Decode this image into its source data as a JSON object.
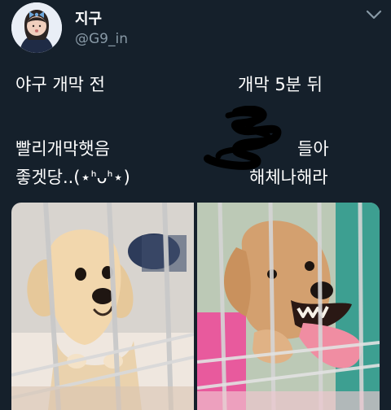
{
  "tweet": {
    "display_name": "지구",
    "handle": "@G9_in",
    "labels": {
      "before_title": "야구 개막 전",
      "after_title": "개막 5분 뒤",
      "before_line1": "빨리개막햇음",
      "before_line2": "좋겟당..(⋆ᑋᴗᑋ⋆)",
      "after_line1": "들아",
      "after_line2": "해체나해라"
    }
  },
  "icons": {
    "avatar": "avatar",
    "more": "chevron-down-icon",
    "scribble": "scribble-redaction"
  }
}
